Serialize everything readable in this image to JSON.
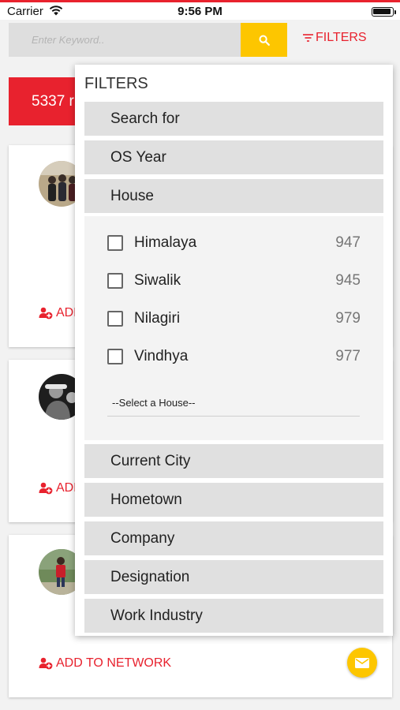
{
  "status_bar": {
    "carrier": "Carrier",
    "time": "9:56 PM"
  },
  "search": {
    "placeholder": "Enter Keyword.."
  },
  "header": {
    "filters_label": "FILTERS"
  },
  "results": {
    "count_text": "5337 r"
  },
  "cards": [
    {
      "add_label": "ADD"
    },
    {
      "add_label": "ADD"
    },
    {
      "add_label": "ADD TO NETWORK"
    }
  ],
  "filter_panel": {
    "title": "FILTERS",
    "sections": {
      "search_for": "Search for",
      "os_year": "OS Year",
      "house": "House",
      "current_city": "Current City",
      "hometown": "Hometown",
      "company": "Company",
      "designation": "Designation",
      "work_industry": "Work Industry"
    },
    "house_options": [
      {
        "label": "Himalaya",
        "count": "947",
        "checked": false
      },
      {
        "label": "Siwalik",
        "count": "945",
        "checked": false
      },
      {
        "label": "Nilagiri",
        "count": "979",
        "checked": false
      },
      {
        "label": "Vindhya",
        "count": "977",
        "checked": false
      }
    ],
    "house_select": "--Select a House--"
  },
  "colors": {
    "accent_red": "#e8222e",
    "accent_yellow": "#fdc600",
    "section_gray": "#e0e0e0"
  },
  "icons": {
    "search": "search-icon",
    "filter": "filter-icon",
    "add_user": "add-user-icon",
    "mail": "mail-icon",
    "wifi": "wifi-icon",
    "battery": "battery-icon"
  }
}
